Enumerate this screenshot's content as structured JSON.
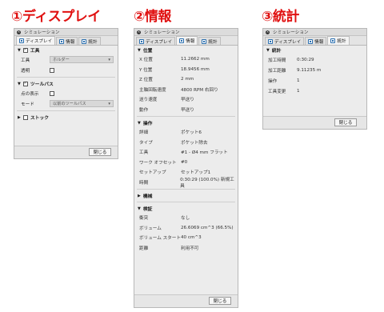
{
  "headings": [
    "①ディスプレイ",
    "②情報",
    "③統計"
  ],
  "window_title": "シミュレーション",
  "tabs": [
    "ディスプレイ",
    "情報",
    "統計"
  ],
  "close_button": "閉じる",
  "display": {
    "tool_section": "工具",
    "tool_label": "工具",
    "tool_value": "ホルダー",
    "transparent_label": "透明",
    "toolpath_section": "ツールパス",
    "points_label": "点の表示",
    "mode_label": "モード",
    "mode_value": "以前のツールパス",
    "stock_section": "ストック",
    "tool_checked": true,
    "transparent_checked": false,
    "toolpath_checked": true,
    "points_checked": false,
    "stock_checked": false
  },
  "info": {
    "position_section": "位置",
    "position": [
      {
        "k": "X 位置",
        "v": "11.2662 mm"
      },
      {
        "k": "Y 位置",
        "v": "18.9456 mm"
      },
      {
        "k": "Z 位置",
        "v": "2 mm"
      },
      {
        "k": "主軸回転速度",
        "v": "4800 RPM 右回り"
      },
      {
        "k": "送り速度",
        "v": "早送り"
      },
      {
        "k": "動作",
        "v": "早送り"
      }
    ],
    "operation_section": "操作",
    "operation": [
      {
        "k": "詳細",
        "v": "ポケット6"
      },
      {
        "k": "タイプ",
        "v": "ポケット除去"
      },
      {
        "k": "工具",
        "v": "#1 - Ø4 mm フラット"
      },
      {
        "k": "ワーク オフセット",
        "v": "#0"
      },
      {
        "k": "セットアップ",
        "v": "セットアップ1"
      },
      {
        "k": "時間",
        "v": "0:30:29 (100.0%) 新規工具"
      }
    ],
    "machine_section": "機械",
    "verify_section": "検証",
    "verify": [
      {
        "k": "衝突",
        "v": "なし"
      },
      {
        "k": "ボリューム",
        "v": "26.6069 cm^3 (66.5%)"
      },
      {
        "k": "ボリューム スタート",
        "v": "40 cm^3"
      },
      {
        "k": "距離",
        "v": "利用不可"
      }
    ]
  },
  "stats": {
    "section": "統計",
    "rows": [
      {
        "k": "加工時間",
        "v": "0:30:29"
      },
      {
        "k": "加工距離",
        "v": "9.11235 m"
      },
      {
        "k": "操作",
        "v": "1"
      },
      {
        "k": "工具変更",
        "v": "1"
      }
    ]
  }
}
